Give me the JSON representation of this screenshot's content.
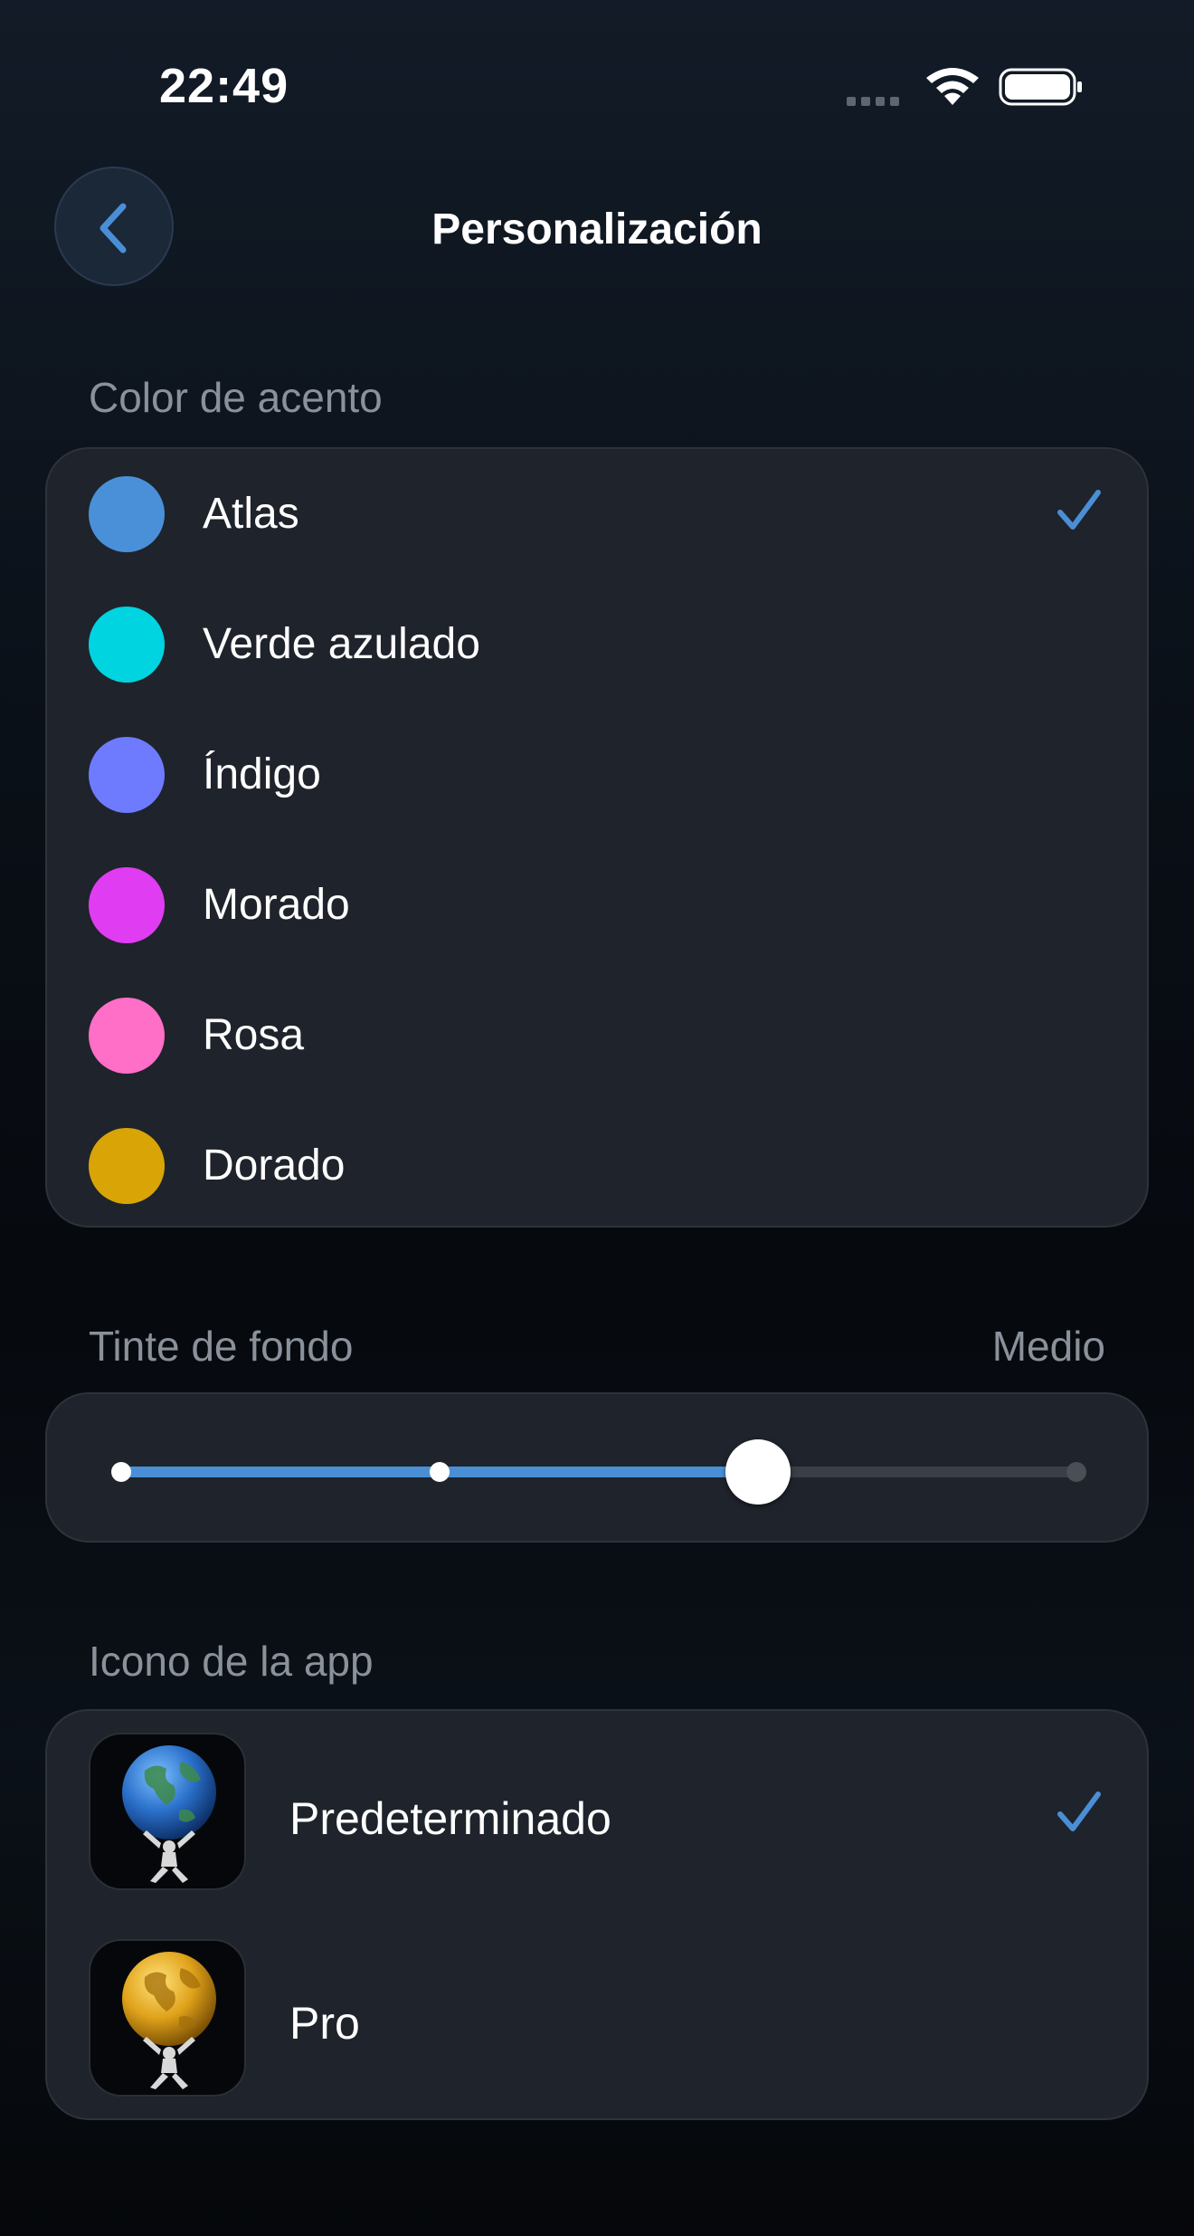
{
  "status_bar": {
    "time": "22:49"
  },
  "header": {
    "title": "Personalización"
  },
  "accent": {
    "section_label": "Color de acento",
    "selected_index": 0,
    "options": [
      {
        "label": "Atlas",
        "color": "#4a90d9"
      },
      {
        "label": "Verde azulado",
        "color": "#00d4e0"
      },
      {
        "label": "Índigo",
        "color": "#6e7bff"
      },
      {
        "label": "Morado",
        "color": "#e03cf2"
      },
      {
        "label": "Rosa",
        "color": "#ff6ec7"
      },
      {
        "label": "Dorado",
        "color": "#d9a406"
      }
    ]
  },
  "tint": {
    "section_label": "Tinte de fondo",
    "value_label": "Medio",
    "level": 0.67,
    "stops": 4,
    "selected_stop": 2
  },
  "app_icon": {
    "section_label": "Icono de la app",
    "selected_index": 0,
    "options": [
      {
        "label": "Predeterminado",
        "icon": "atlas-blue-globe-icon"
      },
      {
        "label": "Pro",
        "icon": "atlas-gold-globe-icon"
      }
    ]
  },
  "colors": {
    "accent": "#4a8fd6",
    "card": "#1f232b",
    "label": "#8a919a"
  }
}
